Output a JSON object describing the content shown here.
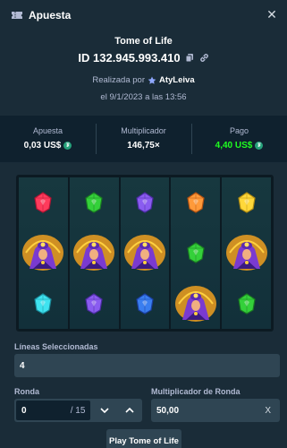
{
  "header": {
    "title": "Apuesta",
    "icon": "ticket-icon",
    "close_icon": "close-icon"
  },
  "game": {
    "name": "Tome of Life"
  },
  "bet": {
    "id": "ID 132.945.993.410",
    "placed_by_label": "Realizada por",
    "user": "AtyLeiva",
    "date": "el 9/1/2023 a las 13:56"
  },
  "stats": {
    "bet_label": "Apuesta",
    "bet_value": "0,03 US$",
    "multiplier_label": "Multiplicador",
    "multiplier_value": "146,75×",
    "payout_label": "Pago",
    "payout_value": "4,40 US$",
    "payout_color": "#1fff20",
    "currency_icon": "tether-coin-icon"
  },
  "reels": [
    [
      "red-gem",
      "sorceress-symbol",
      "cyan-gem"
    ],
    [
      "green-gem",
      "sorceress-symbol",
      "purple-gem"
    ],
    [
      "purple-gem",
      "sorceress-symbol",
      "blue-gem"
    ],
    [
      "orange-gem",
      "green-gem",
      "sorceress-symbol"
    ],
    [
      "yellow-gem",
      "sorceress-symbol",
      "green-gem"
    ]
  ],
  "form": {
    "lines_label": "Líneas Seleccionadas",
    "lines_value": "4",
    "round_label": "Ronda",
    "round_value": "0",
    "round_total": "/ 15",
    "round_multiplier_label": "Multiplicador de Ronda",
    "round_multiplier_value": "50,00",
    "round_multiplier_suffix": "X"
  },
  "play_button": {
    "label": "Play Tome of Life"
  }
}
